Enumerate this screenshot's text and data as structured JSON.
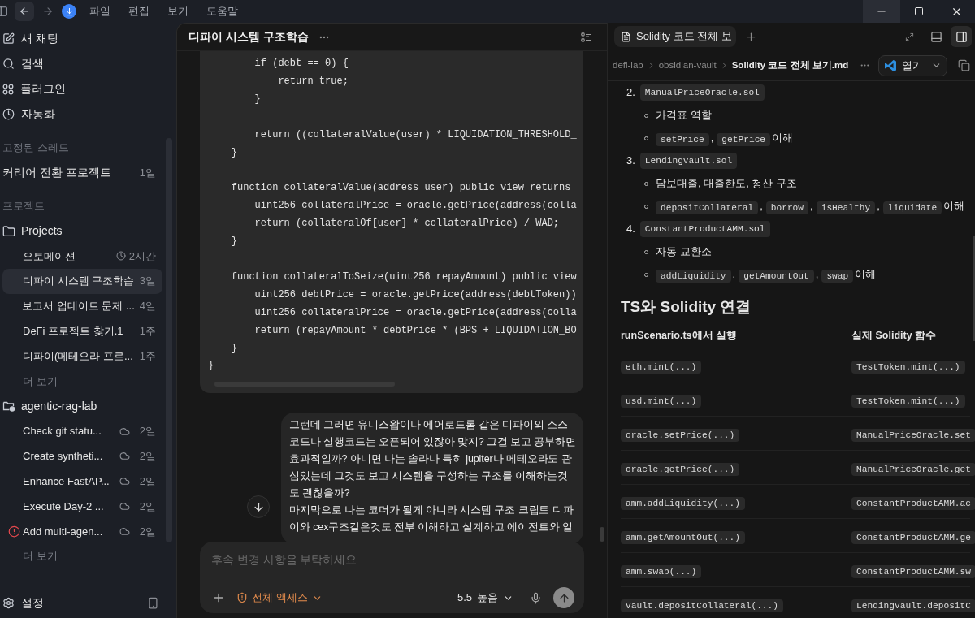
{
  "titlebar": {
    "menu": [
      "파일",
      "편집",
      "보기",
      "도움말"
    ]
  },
  "sidebar": {
    "actions": [
      {
        "kind": "new-chat",
        "label": "새 채팅"
      },
      {
        "kind": "search",
        "label": "검색"
      },
      {
        "kind": "plugins",
        "label": "플러그인"
      },
      {
        "kind": "automation",
        "label": "자동화"
      }
    ],
    "pinned": {
      "title": "고정된 스레드",
      "items": [
        {
          "label": "커리어 전환 프로젝트",
          "meta": "1일",
          "selected": false
        }
      ]
    },
    "projects": {
      "title": "프로젝트",
      "folders": [
        {
          "name": "Projects",
          "kind": "folder",
          "more": "더 보기",
          "threads": [
            {
              "label": "오토메이션",
              "meta": "2시간",
              "kind": "clock",
              "error": false,
              "selected": false
            },
            {
              "label": "디파이 시스템 구조학습",
              "meta": "3일",
              "kind": "plain",
              "error": false,
              "selected": true
            },
            {
              "label": "보고서 업데이트 문제 ...",
              "meta": "4일",
              "kind": "plain",
              "error": false,
              "selected": false
            },
            {
              "label": "DeFi 프로젝트 찾기.1",
              "meta": "1주",
              "kind": "plain",
              "error": false,
              "selected": false
            },
            {
              "label": "디파이(메테오라 프로...",
              "meta": "1주",
              "kind": "plain",
              "error": false,
              "selected": false
            }
          ]
        },
        {
          "name": "agentic-rag-lab",
          "kind": "repo",
          "more": "더 보기",
          "threads": [
            {
              "label": "Check git statu...",
              "meta": "2일",
              "kind": "cloud",
              "error": false,
              "selected": false
            },
            {
              "label": "Create syntheti...",
              "meta": "2일",
              "kind": "cloud",
              "error": false,
              "selected": false
            },
            {
              "label": "Enhance FastAP...",
              "meta": "2일",
              "kind": "cloud",
              "error": false,
              "selected": false
            },
            {
              "label": "Execute Day-2 ...",
              "meta": "2일",
              "kind": "cloud",
              "error": false,
              "selected": false
            },
            {
              "label": "Add multi-agen...",
              "meta": "2일",
              "kind": "cloud",
              "error": true,
              "selected": false
            }
          ]
        }
      ]
    },
    "settings": "설정"
  },
  "chat": {
    "title": "디파이 시스템 구조학습",
    "code": [
      [
        "        if (debt == 0) {",
        "            return true;",
        "        }"
      ],
      [
        "        return ((collateralValue(user) * LIQUIDATION_THRESHOLD_",
        "    }"
      ],
      [
        "    function collateralValue(address user) public view returns",
        "        uint256 collateralPrice = oracle.getPrice(address(colla",
        "        return (collateralOf[user] * collateralPrice) / WAD;",
        "    }"
      ],
      [
        "    function collateralToSeize(uint256 repayAmount) public view",
        "        uint256 debtPrice = oracle.getPrice(address(debtToken))",
        "        uint256 collateralPrice = oracle.getPrice(address(colla",
        "        return (repayAmount * debtPrice * (BPS + LIQUIDATION_BO",
        "    }",
        "}"
      ]
    ],
    "message": {
      "lines": [
        "그런데 그러면 유니스왑이나 에어로드롬 같은 디파이의 소스",
        "코드나 실행코드는 오픈되어 있잖아 맞지? 그걸 보고 공부하면",
        "효과적일까? 아니면 나는 솔라나 특히 jupiter나 메테오라도 관",
        "심있는데 그것도 보고 시스템을 구성하는 구조를 이해하는것",
        "도 괜찮을까?",
        "마지막으로 나는 코더가 될게 아니라 시스템 구조 크립토 디파",
        "이와 cex구조같은것도 전부 이해하고 설계하고 에이전트와 일"
      ]
    },
    "composer": {
      "placeholder": "후속 변경 사항을 부탁하세요",
      "access": "전체 액세스",
      "model": "5.5",
      "effort": "높음"
    }
  },
  "viewer": {
    "tab": "Solidity 코드 전체 보",
    "breadcrumb": [
      "defi-lab",
      "obsidian-vault",
      "Solidity 코드 전체 보기.md"
    ],
    "open_button": "열기",
    "list": [
      {
        "number": "2.",
        "file": "ManualPriceOracle.sol",
        "points": [
          [
            {
              "kind": "text",
              "text": "가격표 역할"
            }
          ],
          [
            {
              "kind": "code",
              "text": "setPrice"
            },
            {
              "kind": "text",
              "text": ","
            },
            {
              "kind": "code",
              "text": "getPrice"
            },
            {
              "kind": "text",
              "text": "이해"
            }
          ]
        ]
      },
      {
        "number": "3.",
        "file": "LendingVault.sol",
        "points": [
          [
            {
              "kind": "text",
              "text": "담보대출, 대출한도, 청산 구조"
            }
          ],
          [
            {
              "kind": "code",
              "text": "depositCollateral"
            },
            {
              "kind": "text",
              "text": ","
            },
            {
              "kind": "code",
              "text": "borrow"
            },
            {
              "kind": "text",
              "text": ","
            },
            {
              "kind": "code",
              "text": "isHealthy"
            },
            {
              "kind": "text",
              "text": ","
            },
            {
              "kind": "code",
              "text": "liquidate"
            },
            {
              "kind": "text",
              "text": "이해"
            }
          ]
        ]
      },
      {
        "number": "4.",
        "file": "ConstantProductAMM.sol",
        "points": [
          [
            {
              "kind": "text",
              "text": "자동 교환소"
            }
          ],
          [
            {
              "kind": "code",
              "text": "addLiquidity"
            },
            {
              "kind": "text",
              "text": ","
            },
            {
              "kind": "code",
              "text": "getAmountOut"
            },
            {
              "kind": "text",
              "text": ","
            },
            {
              "kind": "code",
              "text": "swap"
            },
            {
              "kind": "text",
              "text": "이해"
            }
          ]
        ]
      }
    ],
    "heading": "TS와 Solidity 연결",
    "table": {
      "columns": [
        "runScenario.ts에서 실행",
        "실제 Solidity 함수"
      ],
      "rows": [
        [
          "eth.mint(...)",
          "TestToken.mint(...)"
        ],
        [
          "usd.mint(...)",
          "TestToken.mint(...)"
        ],
        [
          "oracle.setPrice(...)",
          "ManualPriceOracle.set"
        ],
        [
          "oracle.getPrice(...)",
          "ManualPriceOracle.get"
        ],
        [
          "amm.addLiquidity(...)",
          "ConstantProductAMM.ac"
        ],
        [
          "amm.getAmountOut(...)",
          "ConstantProductAMM.ge"
        ],
        [
          "amm.swap(...)",
          "ConstantProductAMM.sw"
        ],
        [
          "vault.depositCollateral(...)",
          "LendingVault.depositC"
        ]
      ]
    }
  }
}
